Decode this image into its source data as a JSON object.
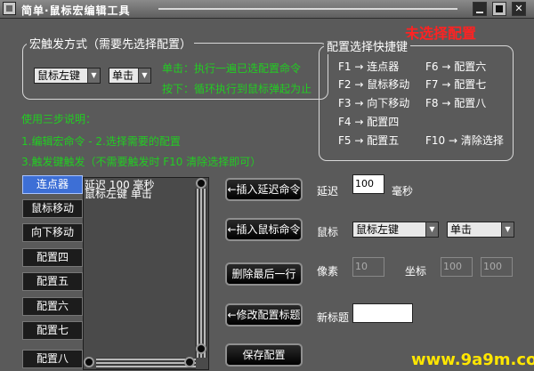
{
  "window": {
    "title": "简单·鼠标宏编辑工具",
    "close_glyph": "✕"
  },
  "status": "未选择配置",
  "macro_group": {
    "legend": "宏触发方式（需要先选择配置）",
    "trigger_button": "鼠标左键",
    "trigger_mode": "单击",
    "hint_click": "单击：执行一遍已选配置命令",
    "hint_hold": "按下：循环执行到鼠标弹起为止"
  },
  "usage": {
    "title": "使用三步说明：",
    "step1": "1.编辑宏命令 - 2.选择需要的配置",
    "step2": "3.触发键触发（不需要触发时 F10 清除选择即可）"
  },
  "config_group": {
    "legend": "配置选择快捷键",
    "arrow": "→",
    "items": [
      {
        "key": "F1",
        "name": "连点器"
      },
      {
        "key": "F2",
        "name": "鼠标移动"
      },
      {
        "key": "F3",
        "name": "向下移动"
      },
      {
        "key": "F4",
        "name": "配置四"
      },
      {
        "key": "F5",
        "name": "配置五"
      },
      {
        "key": "F6",
        "name": "配置六"
      },
      {
        "key": "F7",
        "name": "配置七"
      },
      {
        "key": "F8",
        "name": "配置八"
      },
      {
        "key": "F10",
        "name": "清除选择"
      }
    ]
  },
  "config_list": [
    "连点器",
    "鼠标移动",
    "向下移动",
    "配置四",
    "配置五",
    "配置六",
    "配置七",
    "配置八"
  ],
  "command_list": {
    "lines": [
      "延迟 100 毫秒",
      "鼠标左键 单击"
    ]
  },
  "actions": {
    "insert_delay": "←插入延迟命令",
    "insert_mouse": "←插入鼠标命令",
    "delete_last": "删除最后一行",
    "rename": "←修改配置标题",
    "save": "保存配置"
  },
  "params": {
    "delay_label": "延迟",
    "delay_value": "100",
    "delay_unit": "毫秒",
    "mouse_label": "鼠标",
    "mouse_button": "鼠标左键",
    "mouse_action": "单击",
    "pixel_label": "像素",
    "pixel_value": "10",
    "coord_label": "坐标",
    "coord_x": "100",
    "coord_y": "100",
    "new_title_label": "新标题",
    "new_title_value": ""
  },
  "watermark": "www.9a9m.com",
  "colors": {
    "background": "#5a5a5a",
    "green_text": "#22cc22",
    "status_red": "#ff2222",
    "selected_blue": "#3d6fd6",
    "watermark": "#ffe600"
  }
}
